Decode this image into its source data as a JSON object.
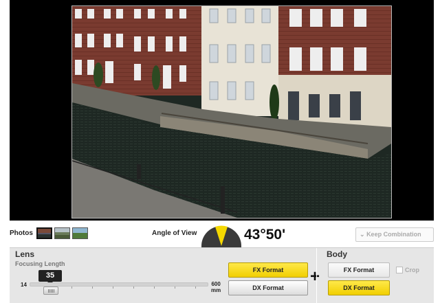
{
  "toolbar": {
    "photos_label": "Photos",
    "angle_label": "Angle of View",
    "angle_value": "43°50'",
    "keep_label": "Keep Combination",
    "keep_icon": "chevron-down-icon"
  },
  "lens": {
    "title": "Lens",
    "focusing_label": "Focusing Length",
    "min": "14",
    "max": "600",
    "max_unit": "mm",
    "current": "35",
    "fx_label": "FX Format",
    "dx_label": "DX Format"
  },
  "body": {
    "title": "Body",
    "fx_label": "FX Format",
    "dx_label": "DX Format",
    "crop_label": "Crop"
  },
  "colors": {
    "active": "#f5d800",
    "gauge": "#3a3a3a"
  }
}
